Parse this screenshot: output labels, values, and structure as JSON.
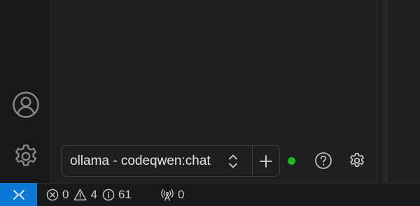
{
  "activity_bar": {
    "account_icon": "account-icon",
    "settings_icon": "gear-icon"
  },
  "chat": {
    "model_selector": {
      "value": "ollama - codeqwen:chat",
      "chevron_icon": "chevron-up-down-icon",
      "add_icon": "plus-icon"
    },
    "connection_status_color": "#1fb81f",
    "help_icon": "help-circle-icon",
    "settings_icon": "gear-icon"
  },
  "status_bar": {
    "remote_icon": "remote-icon",
    "remote_color": "#0a78d4",
    "errors": "0",
    "warnings": "4",
    "infos": "61",
    "ports": "0"
  }
}
